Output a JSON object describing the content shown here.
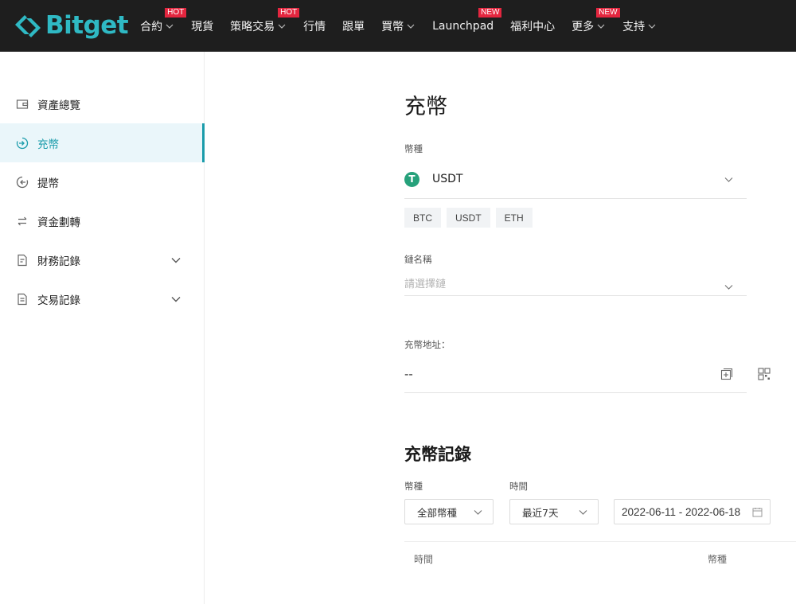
{
  "brand": {
    "name": "Bitget",
    "color": "#2fb9c4"
  },
  "nav": {
    "items": [
      {
        "label": "合約",
        "dropdown": true,
        "badge": "HOT"
      },
      {
        "label": "現貨",
        "dropdown": false,
        "badge": ""
      },
      {
        "label": "策略交易",
        "dropdown": true,
        "badge": "HOT"
      },
      {
        "label": "行情",
        "dropdown": false,
        "badge": ""
      },
      {
        "label": "跟單",
        "dropdown": false,
        "badge": ""
      },
      {
        "label": "買幣",
        "dropdown": true,
        "badge": ""
      },
      {
        "label": "Launchpad",
        "dropdown": false,
        "badge": "NEW"
      },
      {
        "label": "福利中心",
        "dropdown": false,
        "badge": ""
      },
      {
        "label": "更多",
        "dropdown": true,
        "badge": "NEW"
      },
      {
        "label": "支持",
        "dropdown": true,
        "badge": ""
      }
    ]
  },
  "sidebar": {
    "items": [
      {
        "label": "資產總覽",
        "icon": "wallet-icon",
        "active": false,
        "expandable": false
      },
      {
        "label": "充幣",
        "icon": "deposit-icon",
        "active": true,
        "expandable": false
      },
      {
        "label": "提幣",
        "icon": "withdraw-icon",
        "active": false,
        "expandable": false
      },
      {
        "label": "資金劃轉",
        "icon": "transfer-icon",
        "active": false,
        "expandable": false
      },
      {
        "label": "財務記錄",
        "icon": "ledger-icon",
        "active": false,
        "expandable": true
      },
      {
        "label": "交易記錄",
        "icon": "trade-record-icon",
        "active": false,
        "expandable": true
      }
    ]
  },
  "deposit": {
    "title": "充幣",
    "coin_label": "幣種",
    "coin_value": "USDT",
    "coin_icon_letter": "T",
    "quick_coins": [
      "BTC",
      "USDT",
      "ETH"
    ],
    "chain_label": "鏈名稱",
    "chain_placeholder": "請選擇鏈",
    "address_label": "充幣地址：",
    "address_value": "--"
  },
  "records": {
    "title": "充幣記錄",
    "coin_filter_label": "幣種",
    "coin_filter_value": "全部幣種",
    "time_filter_label": "時間",
    "time_filter_value": "最近7天",
    "date_range": "2022-06-1⁠1 - 2022-06-18",
    "columns": [
      "時間",
      "幣種"
    ]
  },
  "colors": {
    "accent": "#1b9cab",
    "topbar": "#1e1e1e",
    "badge": "#e4263f",
    "tether": "#26a17b"
  }
}
